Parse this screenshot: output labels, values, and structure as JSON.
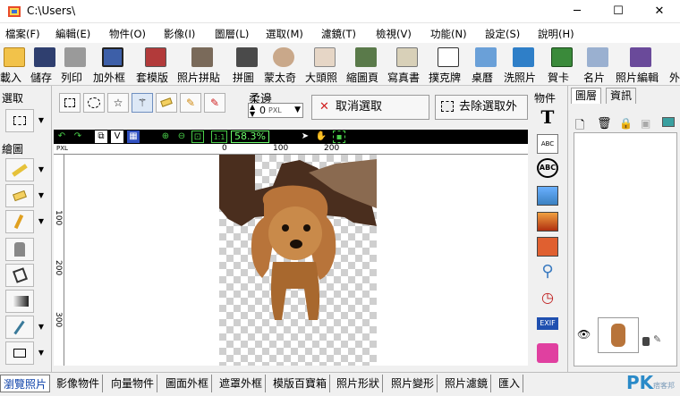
{
  "window": {
    "title": "C:\\Users\\",
    "controls": {
      "minimize": "─",
      "maximize": "☐",
      "close": "✕"
    }
  },
  "menu": [
    "檔案(F)",
    "編輯(E)",
    "物件(O)",
    "影像(I)",
    "圖層(L)",
    "選取(M)",
    "濾鏡(T)",
    "檢視(V)",
    "功能(N)",
    "設定(S)",
    "說明(H)"
  ],
  "toolbar": [
    {
      "label": "載入",
      "icon": "open-folder-icon"
    },
    {
      "label": "儲存",
      "icon": "save-disk-icon"
    },
    {
      "label": "列印",
      "icon": "printer-icon"
    },
    {
      "label": "加外框",
      "icon": "film-frame-icon"
    },
    {
      "label": "套模版",
      "icon": "template-icon"
    },
    {
      "label": "照片拼貼",
      "icon": "collage-icon"
    },
    {
      "label": "拼圖",
      "icon": "puzzle-icon"
    },
    {
      "label": "蒙太奇",
      "icon": "montage-icon"
    },
    {
      "label": "大頭照",
      "icon": "portrait-icon"
    },
    {
      "label": "縮圖頁",
      "icon": "thumbnail-page-icon"
    },
    {
      "label": "寫真書",
      "icon": "photobook-icon"
    },
    {
      "label": "撲克牌",
      "icon": "playing-cards-icon"
    },
    {
      "label": "桌曆",
      "icon": "calendar-icon"
    },
    {
      "label": "洗照片",
      "icon": "print-photo-icon"
    },
    {
      "label": "賀卡",
      "icon": "greeting-card-icon"
    },
    {
      "label": "名片",
      "icon": "business-card-icon"
    },
    {
      "label": "照片編輯",
      "icon": "photo-edit-icon"
    },
    {
      "label": "外",
      "icon": "more-icon"
    }
  ],
  "left_panel": {
    "select_section": "選取",
    "draw_section": "繪圖"
  },
  "selection_bar": {
    "feather_label": "柔邊",
    "feather_value": "0",
    "feather_unit": "PXL",
    "cancel_selection": "取消選取",
    "remove_outside": "去除選取外"
  },
  "view_bar": {
    "zoom": "58.3%"
  },
  "ruler": {
    "h_ticks": [
      "0",
      "100",
      "200"
    ],
    "v_ticks": [
      "100",
      "200",
      "300"
    ],
    "unit": "PXL"
  },
  "object_panel": {
    "title": "物件",
    "icons": [
      "text-icon",
      "abc-text-box-icon",
      "abc-circle-text-icon",
      "image-icon",
      "sunset-image-icon",
      "frames-icon",
      "magnifier-icon",
      "clock-icon",
      "exif-icon",
      "birthday-cake-icon"
    ],
    "exif_label": "EXIF"
  },
  "layer_panel": {
    "tabs": [
      "圖層",
      "資訊"
    ]
  },
  "bottom_tabs": [
    "瀏覽照片",
    "影像物件",
    "向量物件",
    "圖面外框",
    "遮罩外框",
    "模版百寶箱",
    "照片形狀",
    "照片變形",
    "照片濾鏡",
    "匯入"
  ],
  "watermark": {
    "brand": "PK",
    "sub": "痞客邦"
  },
  "colors": {
    "accent_blue": "#0a3fa8",
    "zoom_green": "#6cff6c",
    "canvas_black": "#000000"
  }
}
